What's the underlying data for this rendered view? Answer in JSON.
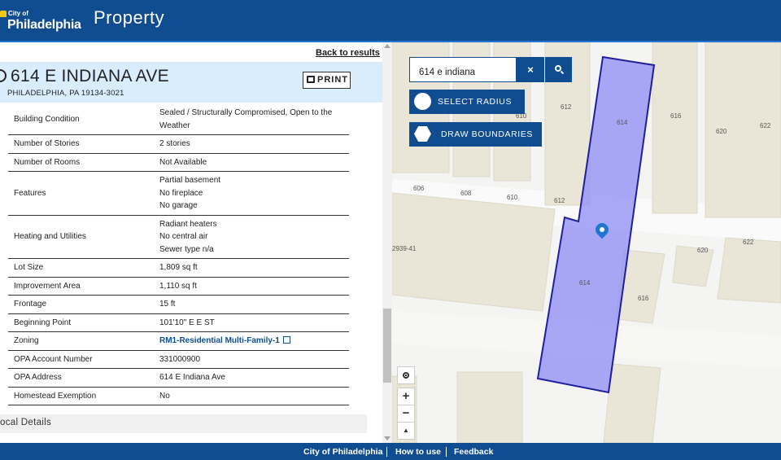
{
  "header": {
    "logo_small": "City of",
    "logo_big": "Philadelphia",
    "app_title": "Property"
  },
  "left": {
    "back_link": "Back to results",
    "address": "614 E INDIANA AVE",
    "address_sub": "PHILADELPHIA, PA 19134-3021",
    "print_label": "PRINT",
    "rows": [
      {
        "k": "Building Condition",
        "v": [
          "Sealed / Structurally Compromised, Open to the",
          "Weather"
        ]
      },
      {
        "k": "Number of Stories",
        "v": [
          "2 stories"
        ]
      },
      {
        "k": "Number of Rooms",
        "v": [
          "Not Available"
        ]
      },
      {
        "k": "Features",
        "v": [
          "Partial basement",
          "No fireplace",
          "No garage"
        ]
      },
      {
        "k": "Heating and Utilities",
        "v": [
          "Radiant heaters",
          "No central air",
          "Sewer type n/a"
        ]
      },
      {
        "k": "Lot Size",
        "v": [
          "1,809 sq ft"
        ]
      },
      {
        "k": "Improvement Area",
        "v": [
          "1,110 sq ft"
        ]
      },
      {
        "k": "Frontage",
        "v": [
          "15 ft"
        ]
      },
      {
        "k": "Beginning Point",
        "v": [
          "101'10\" E E ST"
        ]
      },
      {
        "k": "Zoning",
        "v": [
          "RM1-Residential Multi-Family-1"
        ],
        "link": true
      },
      {
        "k": "OPA Account Number",
        "v": [
          "331000900"
        ]
      },
      {
        "k": "OPA Address",
        "v": [
          "614 E Indiana Ave"
        ]
      },
      {
        "k": "Homestead Exemption",
        "v": [
          "No"
        ]
      }
    ],
    "local_details": "ocal Details"
  },
  "map": {
    "search_value": "614 e indiana",
    "clear_label": "×",
    "select_radius": "SELECT RADIUS",
    "draw_boundaries": "DRAW BOUNDARIES",
    "zoom_in": "+",
    "zoom_out": "−",
    "compass": "▲",
    "labels": {
      "l612a": "612",
      "l614a": "614",
      "l616a": "616",
      "l620a": "620",
      "l622a": "622",
      "l610a": "610",
      "l606": "606",
      "l608": "608",
      "l610b": "610",
      "l612b": "612",
      "l2939": "2939-41",
      "l620b": "620",
      "l622b": "622",
      "l614b": "614",
      "l616b": "616"
    },
    "highlight_color": "#8c8cf5"
  },
  "footer": {
    "link1": "City of Philadelphia",
    "link2": "How to use",
    "link3": "Feedback"
  }
}
